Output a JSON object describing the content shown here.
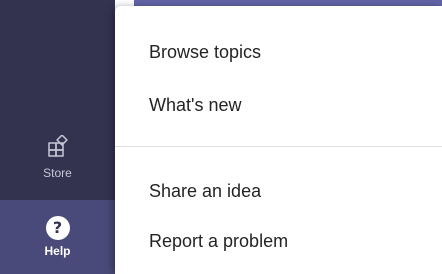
{
  "rail": {
    "items": [
      {
        "label": "Store",
        "icon": "store-icon"
      },
      {
        "label": "Help",
        "icon": "help-icon"
      }
    ]
  },
  "menu": {
    "items": [
      {
        "label": "Browse topics"
      },
      {
        "label": "What's new"
      },
      {
        "label": "Share an idea"
      },
      {
        "label": "Report a problem"
      }
    ]
  },
  "colors": {
    "rail": "#34334f",
    "rail_selected": "#4a4a7a",
    "accent": "#6264a7",
    "menu_text": "#252423"
  }
}
